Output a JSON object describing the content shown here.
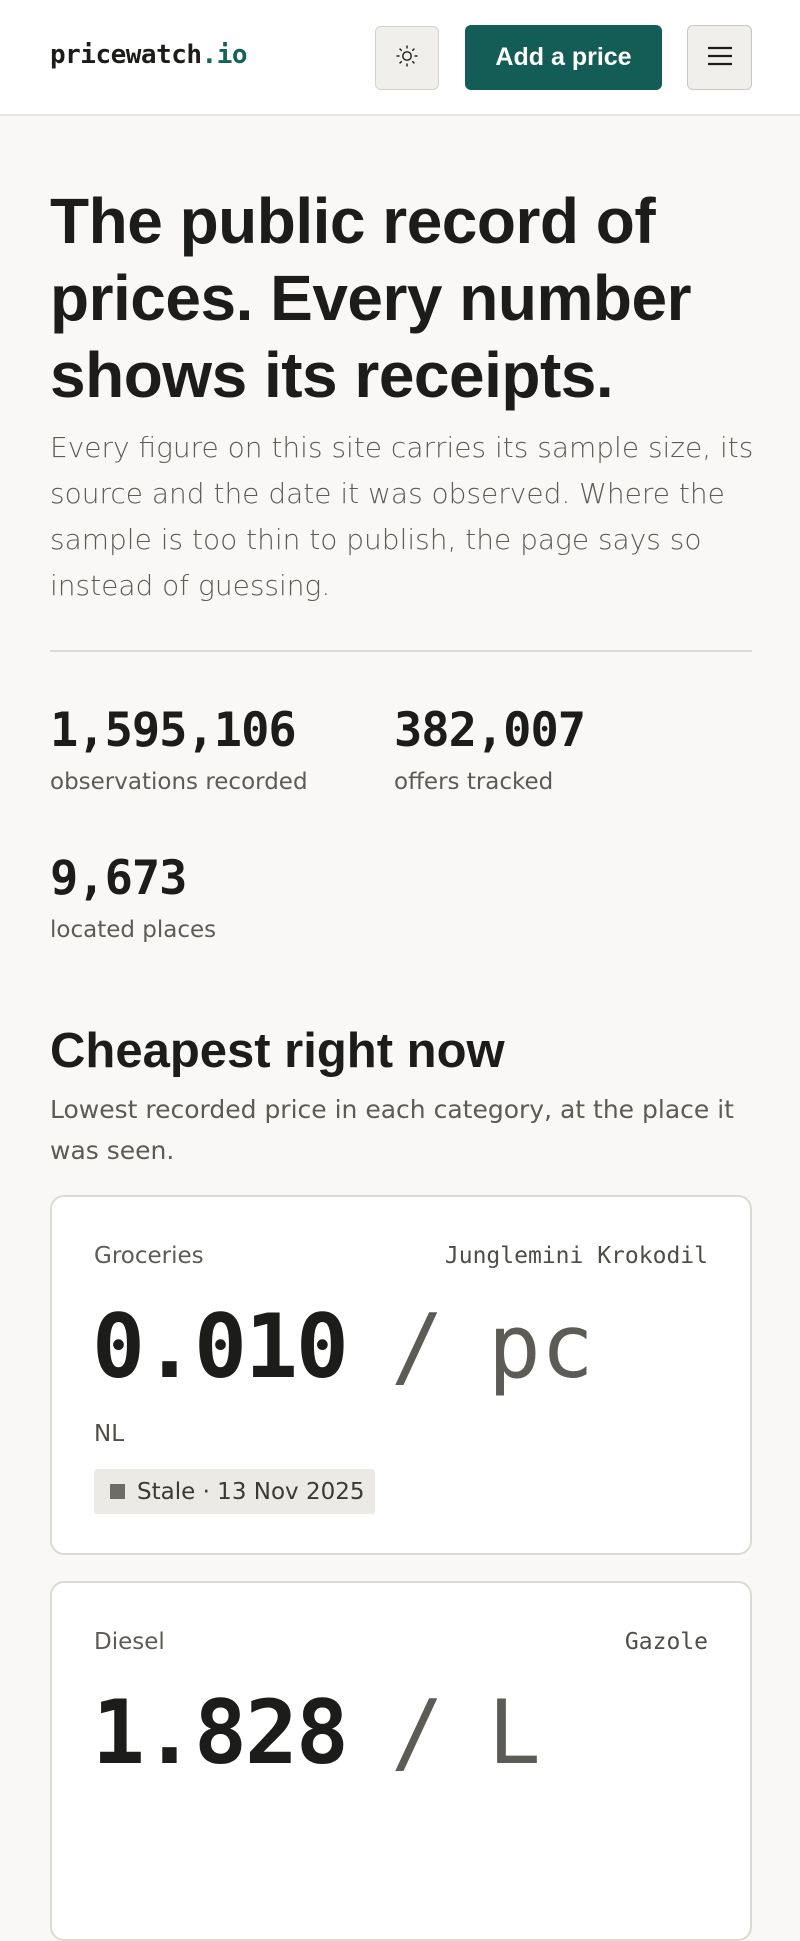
{
  "header": {
    "logo_main": "pricewatch",
    "logo_tld": ".io",
    "theme_icon": "sun-icon",
    "add_price_label": "Add a price",
    "menu_icon": "hamburger-menu-icon"
  },
  "hero": {
    "title": "The public record of prices. Every number shows its receipts.",
    "subtitle": "Every figure on this site carries its sample size, its source and the date it was observed. Where the sample is too thin to publish, the page says so instead of guessing."
  },
  "stats": [
    {
      "value": "1,595,106",
      "label": "observations recorded"
    },
    {
      "value": "382,007",
      "label": "offers tracked"
    },
    {
      "value": "9,673",
      "label": "located places"
    }
  ],
  "cheapest": {
    "title": "Cheapest right now",
    "subtitle": "Lowest recorded price in each category, at the place it was seen.",
    "cards": [
      {
        "category": "Groceries",
        "place": "Junglemini Krokodil",
        "price": "0.010",
        "separator": "/",
        "unit": "pc",
        "country": "NL",
        "badge": "Stale · 13 Nov 2025"
      },
      {
        "category": "Diesel",
        "place": "Gazole",
        "price": "1.828",
        "separator": "/",
        "unit": "L"
      }
    ]
  },
  "colors": {
    "accent": "#135d56",
    "background": "#f9f8f6",
    "text": "#1c1c1a",
    "muted": "#5d5b55"
  }
}
